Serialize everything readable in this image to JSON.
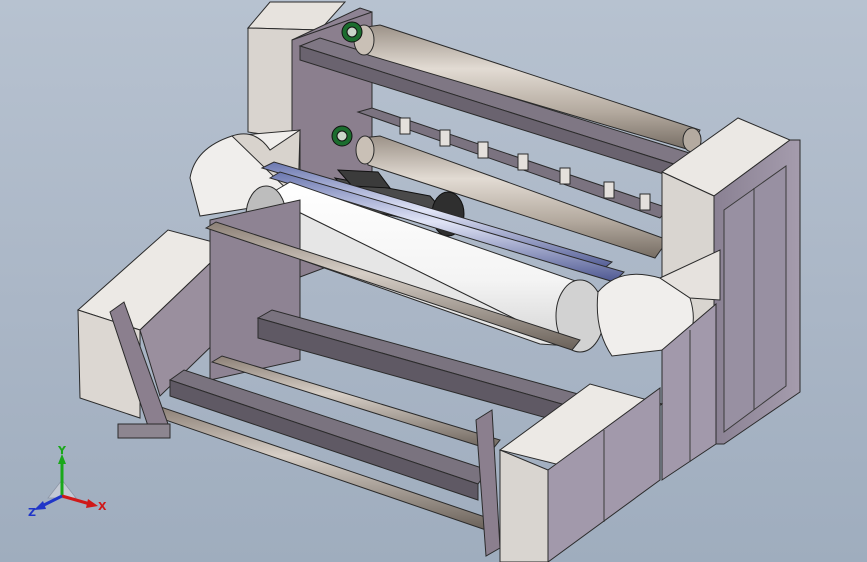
{
  "scene": {
    "description_free": true,
    "background_color": "#aab6c6"
  },
  "triad": {
    "x_label": "X",
    "y_label": "Y",
    "z_label": "Z",
    "colors": {
      "x": "#d01818",
      "y": "#1aa81a",
      "z": "#1f35c8"
    }
  }
}
